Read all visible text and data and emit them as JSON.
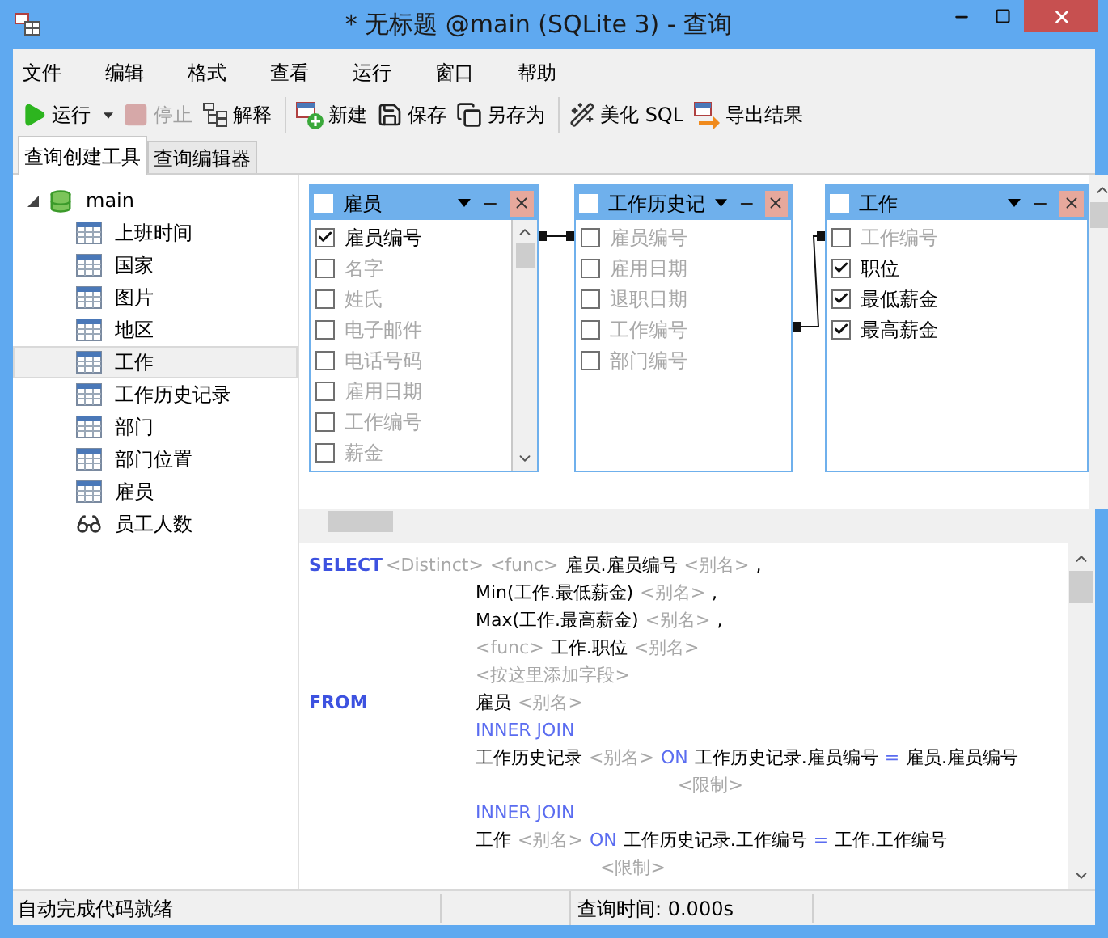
{
  "window": {
    "title": "* 无标题 @main (SQLite 3) - 查询"
  },
  "menu": [
    "文件",
    "编辑",
    "格式",
    "查看",
    "运行",
    "窗口",
    "帮助"
  ],
  "toolbar": [
    {
      "items": [
        {
          "kind": "run",
          "label": "运行",
          "disabled": false,
          "dropdown": true
        },
        {
          "kind": "stop",
          "label": "停止",
          "disabled": true,
          "dropdown": false
        },
        {
          "kind": "explain",
          "label": "解释",
          "disabled": false,
          "dropdown": false
        }
      ]
    },
    {
      "items": [
        {
          "kind": "new",
          "label": "新建",
          "disabled": false,
          "dropdown": false
        },
        {
          "kind": "save",
          "label": "保存",
          "disabled": false,
          "dropdown": false
        },
        {
          "kind": "save_as",
          "label": "另存为",
          "disabled": false,
          "dropdown": false
        }
      ]
    },
    {
      "items": [
        {
          "kind": "beautify",
          "label": "美化 SQL",
          "disabled": false,
          "dropdown": false
        },
        {
          "kind": "export",
          "label": "导出结果",
          "disabled": false,
          "dropdown": false
        }
      ]
    }
  ],
  "tabs": [
    {
      "label": "查询创建工具",
      "selected": true
    },
    {
      "label": "查询编辑器",
      "selected": false
    }
  ],
  "tree": [
    {
      "label": "main",
      "kind": "database",
      "expanded": true,
      "selected": false,
      "children": [
        {
          "label": "上班时间",
          "kind": "table",
          "selected": false
        },
        {
          "label": "国家",
          "kind": "table",
          "selected": false
        },
        {
          "label": "图片",
          "kind": "table",
          "selected": false
        },
        {
          "label": "地区",
          "kind": "table",
          "selected": false
        },
        {
          "label": "工作",
          "kind": "table",
          "selected": true
        },
        {
          "label": "工作历史记录",
          "kind": "table",
          "selected": false
        },
        {
          "label": "部门",
          "kind": "table",
          "selected": false
        },
        {
          "label": "部门位置",
          "kind": "table",
          "selected": false
        },
        {
          "label": "雇员",
          "kind": "table",
          "selected": false
        },
        {
          "label": "员工人数",
          "kind": "view",
          "selected": false
        }
      ]
    }
  ],
  "designer": {
    "tables": [
      {
        "title": "雇员",
        "checked": false,
        "scrollable": true,
        "fields": [
          {
            "name": "雇员编号",
            "checked": true
          },
          {
            "name": "名字",
            "checked": false
          },
          {
            "name": "姓氏",
            "checked": false
          },
          {
            "name": "电子邮件",
            "checked": false
          },
          {
            "name": "电话号码",
            "checked": false
          },
          {
            "name": "雇用日期",
            "checked": false
          },
          {
            "name": "工作编号",
            "checked": false
          },
          {
            "name": "薪金",
            "checked": false
          }
        ]
      },
      {
        "title": "工作历史记",
        "checked": false,
        "scrollable": false,
        "fields": [
          {
            "name": "雇员编号",
            "checked": false
          },
          {
            "name": "雇用日期",
            "checked": false
          },
          {
            "name": "退职日期",
            "checked": false
          },
          {
            "name": "工作编号",
            "checked": false
          },
          {
            "name": "部门编号",
            "checked": false
          }
        ]
      },
      {
        "title": "工作",
        "checked": false,
        "scrollable": false,
        "fields": [
          {
            "name": "工作编号",
            "checked": false
          },
          {
            "name": "职位",
            "checked": true
          },
          {
            "name": "最低薪金",
            "checked": true
          },
          {
            "name": "最高薪金",
            "checked": true
          }
        ]
      }
    ]
  },
  "sql": [
    {
      "kind": "clause",
      "lead": [
        {
          "kind": "keyword",
          "text": "SELECT"
        },
        {
          "kind": "placeholder",
          "text": "<Distinct>"
        }
      ],
      "body": [
        {
          "kind": "placeholder",
          "text": "<func>"
        },
        {
          "kind": "text",
          "text": "雇员.雇员编号"
        },
        {
          "kind": "placeholder",
          "text": "<别名>"
        },
        {
          "kind": "text",
          "text": ","
        }
      ]
    },
    {
      "kind": "field",
      "body": [
        {
          "kind": "text",
          "text": "Min(工作.最低薪金)"
        },
        {
          "kind": "placeholder",
          "text": "<别名>"
        },
        {
          "kind": "text",
          "text": ","
        }
      ]
    },
    {
      "kind": "field",
      "body": [
        {
          "kind": "text",
          "text": "Max(工作.最高薪金)"
        },
        {
          "kind": "placeholder",
          "text": "<别名>"
        },
        {
          "kind": "text",
          "text": ","
        }
      ]
    },
    {
      "kind": "field",
      "body": [
        {
          "kind": "placeholder",
          "text": "<func>"
        },
        {
          "kind": "text",
          "text": "工作.职位"
        },
        {
          "kind": "placeholder",
          "text": "<别名>"
        }
      ]
    },
    {
      "kind": "field",
      "body": [
        {
          "kind": "placeholder",
          "text": "<按这里添加字段>"
        }
      ]
    },
    {
      "kind": "clause",
      "lead": [
        {
          "kind": "keyword",
          "text": "FROM"
        }
      ],
      "body": [
        {
          "kind": "text",
          "text": "雇员"
        },
        {
          "kind": "placeholder",
          "text": "<别名>"
        }
      ]
    },
    {
      "kind": "field",
      "body": [
        {
          "kind": "join",
          "text": "INNER JOIN"
        }
      ]
    },
    {
      "kind": "field",
      "body": [
        {
          "kind": "text",
          "text": "工作历史记录"
        },
        {
          "kind": "placeholder",
          "text": "<别名>"
        },
        {
          "kind": "join",
          "text": "ON"
        },
        {
          "kind": "text",
          "text": "工作历史记录.雇员编号"
        },
        {
          "kind": "join",
          "text": "="
        },
        {
          "kind": "text",
          "text": "雇员.雇员编号"
        }
      ]
    },
    {
      "kind": "restriction",
      "body": [
        {
          "kind": "placeholder",
          "text": "<限制>"
        }
      ]
    },
    {
      "kind": "field",
      "body": [
        {
          "kind": "join",
          "text": "INNER JOIN"
        }
      ]
    },
    {
      "kind": "field",
      "body": [
        {
          "kind": "text",
          "text": "工作"
        },
        {
          "kind": "placeholder",
          "text": "<别名>"
        },
        {
          "kind": "join",
          "text": "ON"
        },
        {
          "kind": "text",
          "text": "工作历史记录.工作编号"
        },
        {
          "kind": "join",
          "text": "="
        },
        {
          "kind": "text",
          "text": "工作.工作编号"
        }
      ]
    },
    {
      "kind": "restriction_short",
      "body": [
        {
          "kind": "placeholder",
          "text": "<限制>"
        }
      ]
    }
  ],
  "status_bar": {
    "message": "自动完成代码就绪",
    "query_time": "查询时间: 0.000s"
  }
}
